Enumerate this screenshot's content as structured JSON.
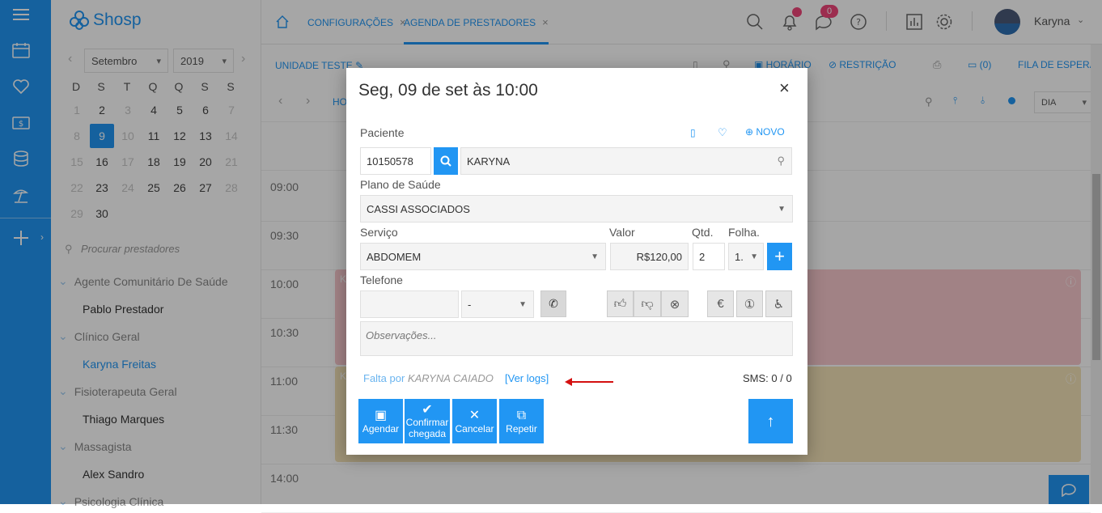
{
  "app": {
    "brand": "Shosp",
    "accent": "#2196f3"
  },
  "header": {
    "tabs": [
      {
        "label": "CONFIGURAÇÕES"
      },
      {
        "label": "AGENDA DE PRESTADORES"
      }
    ],
    "messages_badge": "0",
    "user_name": "Karyna"
  },
  "sidebar": {
    "month": "Setembro",
    "year": "2019",
    "weekdays": [
      "D",
      "S",
      "T",
      "Q",
      "Q",
      "S",
      "S"
    ],
    "weeks": [
      [
        "1",
        "2",
        "3",
        "4",
        "5",
        "6",
        "7"
      ],
      [
        "8",
        "9",
        "10",
        "11",
        "12",
        "13",
        "14"
      ],
      [
        "15",
        "16",
        "17",
        "18",
        "19",
        "20",
        "21"
      ],
      [
        "22",
        "23",
        "24",
        "25",
        "26",
        "27",
        "28"
      ],
      [
        "29",
        "30"
      ]
    ],
    "search_placeholder": "Procurar prestadores",
    "groups": [
      {
        "label": "Agente Comunitário De Saúde",
        "items": [
          "Pablo Prestador"
        ]
      },
      {
        "label": "Clínico Geral",
        "items": [
          "Karyna Freitas"
        ]
      },
      {
        "label": "Fisioterapeuta Geral",
        "items": [
          "Thiago Marques"
        ]
      },
      {
        "label": "Massagista",
        "items": [
          "Alex Sandro"
        ]
      },
      {
        "label": "Psicologia Clínica",
        "items": []
      }
    ]
  },
  "toolbar": {
    "unit": "UNIDADE TESTE",
    "nav_label": "HO",
    "horario": "HORÁRIO",
    "restricao": "RESTRIÇÃO",
    "queue_count": "(0)",
    "fila": "FILA DE ESPERA",
    "view": "DIA"
  },
  "times": [
    "09:00",
    "09:30",
    "10:00",
    "10:30",
    "11:00",
    "11:30",
    "14:00"
  ],
  "appointments": [
    {
      "initial": "K",
      "sub": "1",
      "color": "#f7c8cc"
    },
    {
      "initial": "K",
      "sub": "1",
      "color": "#f3e2b7"
    }
  ],
  "modal": {
    "title": "Seg, 09 de set às 10:00",
    "patient_label": "Paciente",
    "novo_label": "NOVO",
    "patient_id": "10150578",
    "patient_name": "KARYNA",
    "plan_label": "Plano de Saúde",
    "plan_value": "CASSI ASSOCIADOS",
    "service_label": "Serviço",
    "value_label": "Valor",
    "qty_label": "Qtd.",
    "sheet_label": "Folha.",
    "service_value": "ABDOMEM",
    "price": "R$120,00",
    "qty": "2",
    "sheet": "1.",
    "phone_label": "Telefone",
    "phone_value": "",
    "phone_type": "-",
    "notes_placeholder": "Observações...",
    "falta_prefix": "Falta por",
    "falta_name": "KARYNA CAIADO",
    "logs_link": "[Ver logs]",
    "sms": "SMS: 0 / 0",
    "actions": [
      {
        "label": "Agendar"
      },
      {
        "label": "Confirmar chegada"
      },
      {
        "label": "Cancelar"
      },
      {
        "label": "Repetir"
      }
    ]
  }
}
